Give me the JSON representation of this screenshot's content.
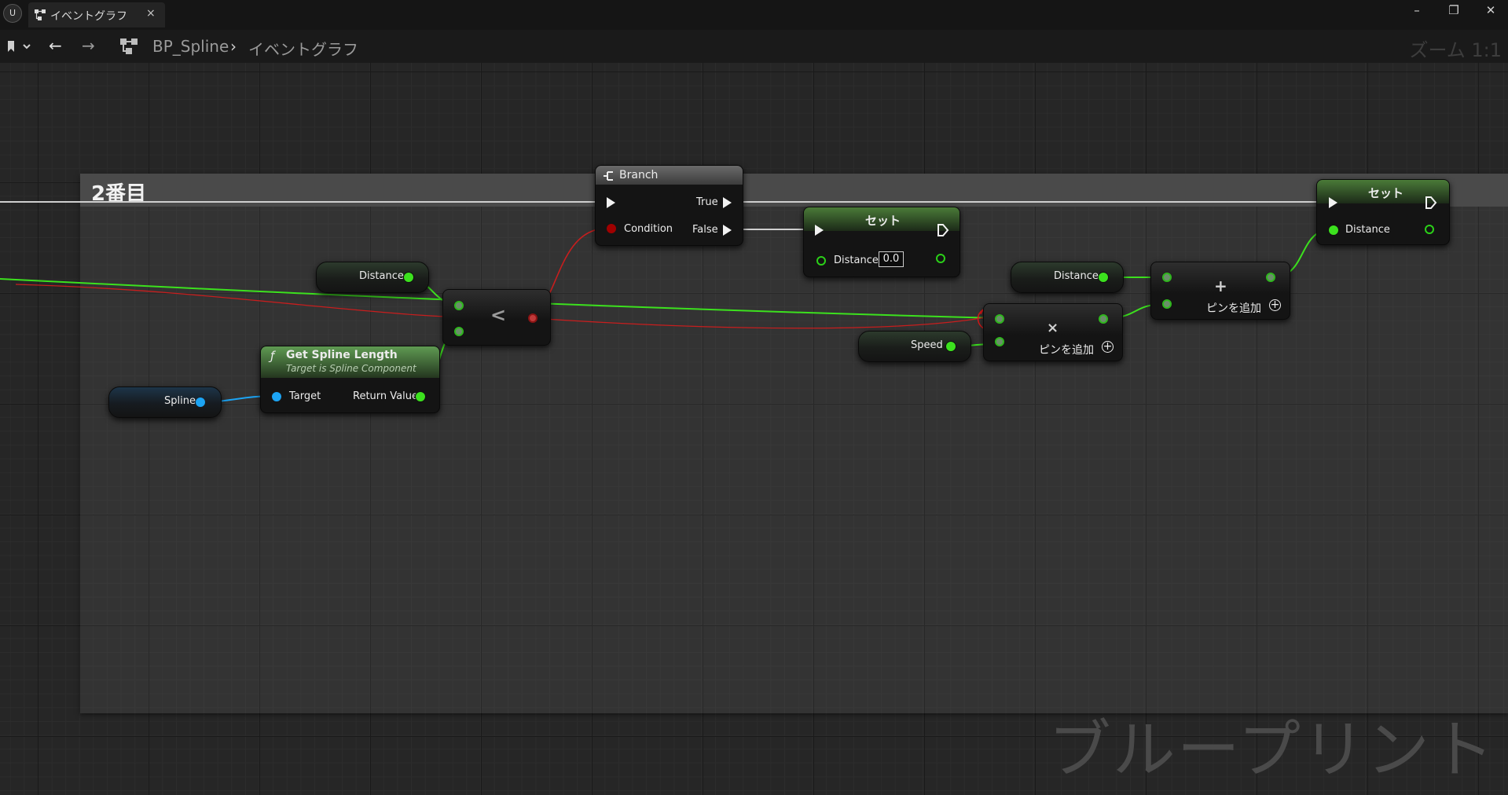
{
  "window": {
    "tab_title": "イベントグラフ",
    "close_glyph": "×",
    "minimize": "–",
    "restore": "❐",
    "close": "✕"
  },
  "toolbar": {
    "back": "←",
    "forward": "→",
    "bp_name": "BP_Spline",
    "separator": "›",
    "graph_name": "イベントグラフ",
    "zoom": "ズーム 1:1"
  },
  "comment": {
    "title": "2番目"
  },
  "nodes": {
    "branch": {
      "title": "Branch",
      "true_label": "True",
      "condition_label": "Condition",
      "false_label": "False"
    },
    "set1": {
      "title": "セット",
      "distance_label": "Distance",
      "distance_value": "0.0"
    },
    "set2": {
      "title": "セット",
      "distance_label": "Distance"
    },
    "distance_get1": {
      "label": "Distance"
    },
    "distance_get2": {
      "label": "Distance"
    },
    "speed_get": {
      "label": "Speed"
    },
    "spline_get": {
      "label": "Spline"
    },
    "less": {
      "symbol": "<"
    },
    "get_spline_length": {
      "title": "Get Spline Length",
      "subtitle": "Target is Spline Component",
      "target_label": "Target",
      "return_label": "Return Value"
    },
    "multiply": {
      "symbol": "×",
      "add_pin": "ピンを追加"
    },
    "add": {
      "symbol": "+",
      "add_pin": "ピンを追加"
    }
  },
  "watermark": "ブループリント",
  "colors": {
    "float_pin": "#3ce11e",
    "object_pin": "#1ca4f4",
    "bool_pin": "#a00000",
    "exec": "#f2f2f2",
    "graph_bg": "#262626",
    "comment_header": "#4a4a4a"
  }
}
